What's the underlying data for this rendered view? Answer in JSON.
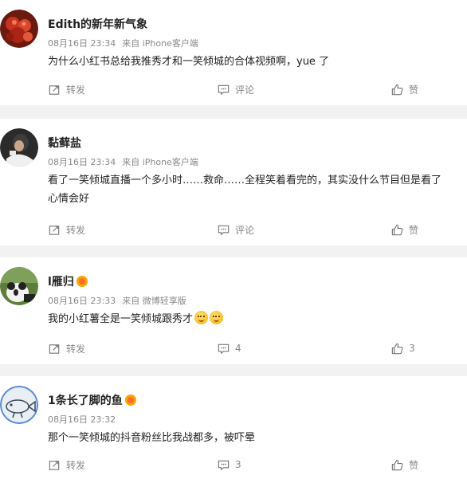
{
  "posts": [
    {
      "author": "Edith的新年新气象",
      "has_badge": false,
      "date": "08月16日 23:34",
      "source": "来自 iPhone客户端",
      "lines": [
        "为什么小红书总给我推秀才和一笑倾城的合体视频啊，yue 了"
      ],
      "repost_label": "转发",
      "comment_label": "评论",
      "like_label": "赞"
    },
    {
      "author": "黏藓盐",
      "has_badge": false,
      "date": "08月16日 23:34",
      "source": "来自 iPhone客户端",
      "lines": [
        "看了一笑倾城直播一个多小时……救命……全程笑着看完的，其实没什么节目但是看了",
        "心情会好"
      ],
      "repost_label": "转发",
      "comment_label": "评论",
      "like_label": "赞"
    },
    {
      "author": "l雁归",
      "has_badge": true,
      "date": "08月16日 23:33",
      "source": "来自 微博轻享版",
      "lines": [
        "我的小红薯全是一笑倾城跟秀才"
      ],
      "emoji_count": 2,
      "repost_label": "转发",
      "comment_label": "4",
      "like_label": "3"
    },
    {
      "author": "1条长了脚的鱼",
      "has_badge": true,
      "date": "08月16日 23:32",
      "source": "",
      "lines": [
        "那个一笑倾城的抖音粉丝比我战都多，被吓晕"
      ],
      "repost_label": "转发",
      "comment_label": "3",
      "like_label": "赞"
    }
  ],
  "icons": {
    "repost": "repost-icon",
    "comment": "comment-icon",
    "like": "thumbs-up-icon",
    "badge": "vip-badge-icon",
    "emoji": "smile-emoji-icon"
  },
  "colors": {
    "background": "#f2f2f2",
    "card": "#ffffff",
    "meta_text": "#888888",
    "badge": "#f6a700"
  }
}
